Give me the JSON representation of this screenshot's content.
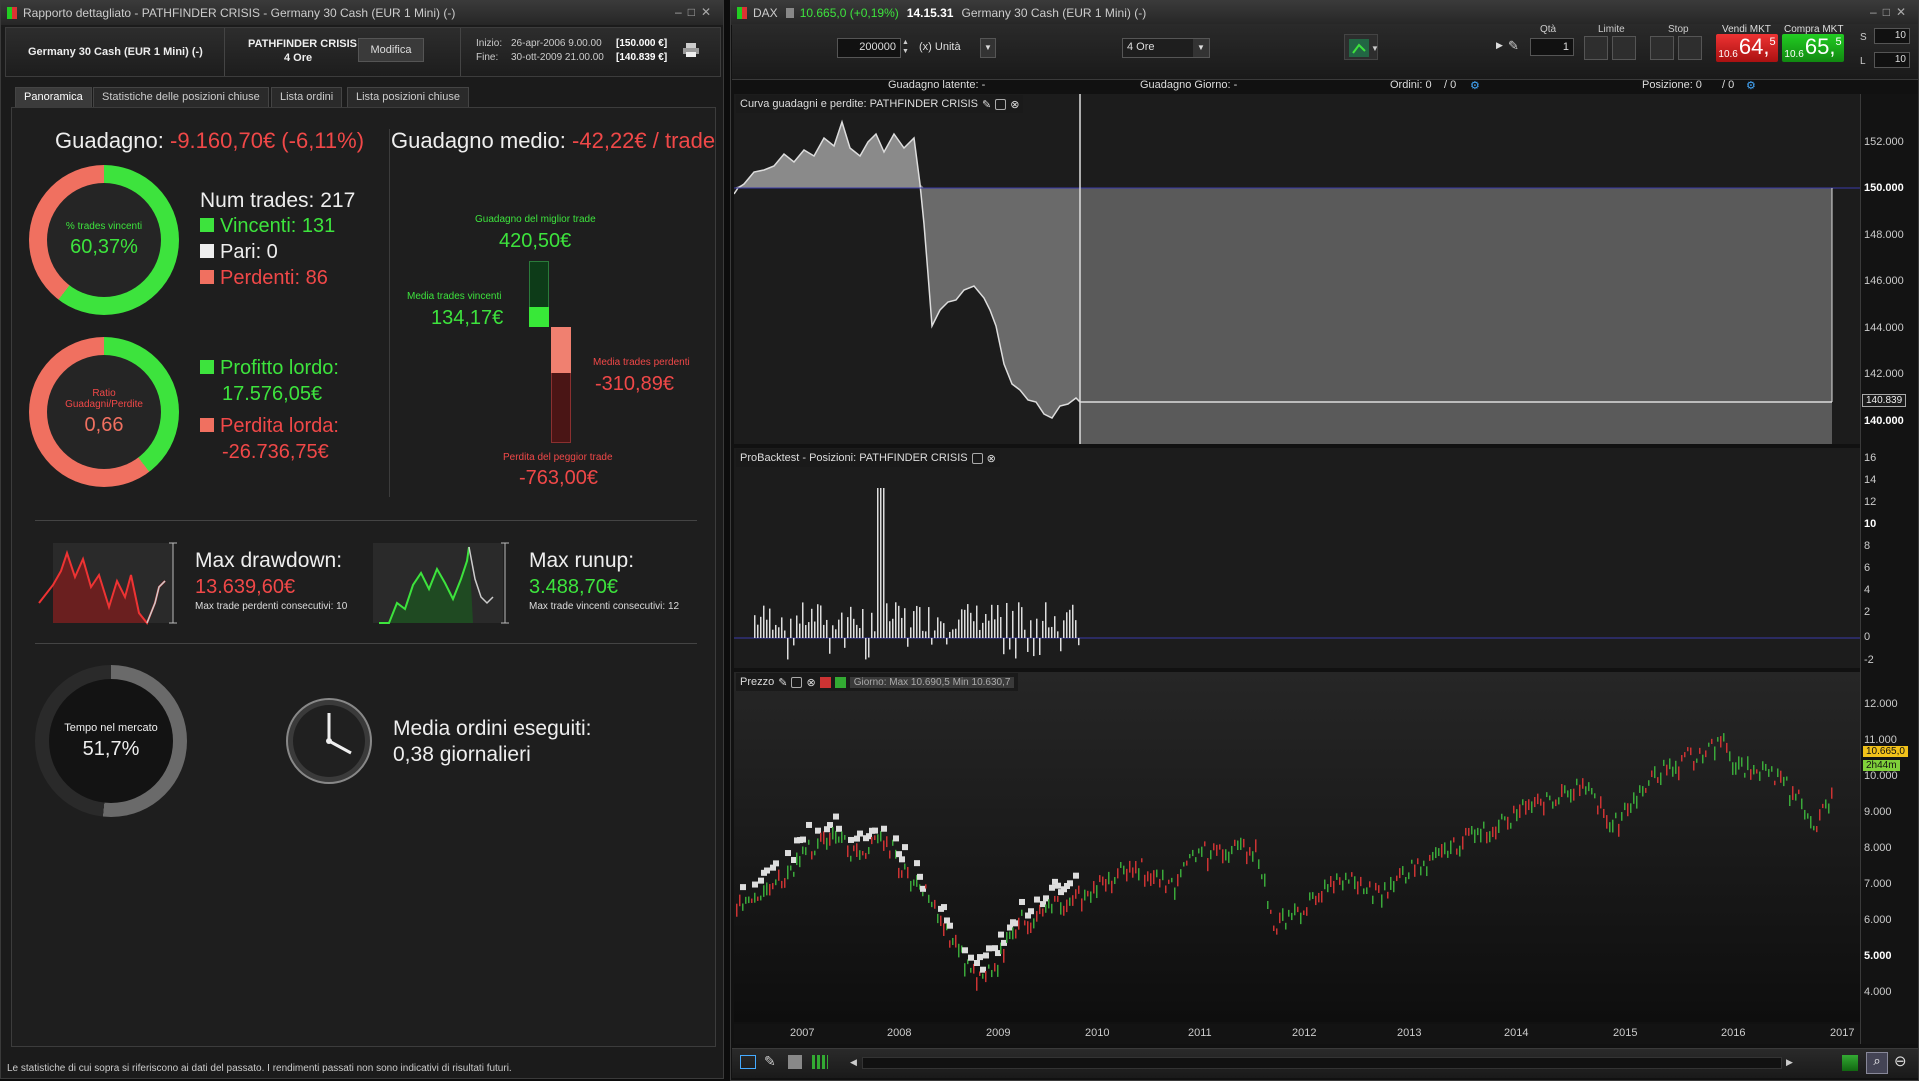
{
  "left_window": {
    "title": "Rapporto dettagliato - PATHFINDER CRISIS - Germany 30 Cash (EUR 1 Mini) (-)",
    "instrument": "Germany 30 Cash (EUR 1 Mini) (-)",
    "system_name": "PATHFINDER CRISIS",
    "timeframe": "4 Ore",
    "modify_label": "Modifica",
    "start_label": "Inizio:",
    "start_value": "26-apr-2006 9.00.00",
    "start_capital": "[150.000 €]",
    "end_label": "Fine:",
    "end_value": "30-ott-2009 21.00.00",
    "end_capital": "[140.839 €]",
    "tabs": [
      {
        "label": "Panoramica"
      },
      {
        "label": "Statistiche delle posizioni chiuse"
      },
      {
        "label": "Lista ordini"
      },
      {
        "label": "Lista posizioni chiuse"
      }
    ],
    "gain_label": "Guadagno:",
    "gain_value": "-9.160,70€ (-6,11%)",
    "avg_gain_label": "Guadagno medio:",
    "avg_gain_value": "-42,22€ / trade",
    "win_pct_label": "% trades vincenti",
    "win_pct_value": "60,37%",
    "win_pct_fraction": 0.6037,
    "num_trades": "Num trades: 217",
    "winners": "Vincenti: 131",
    "even": "Pari: 0",
    "losers": "Perdenti: 86",
    "ratio_label": "Ratio Guadagni/Perdite",
    "ratio_value": "0,66",
    "ratio_fraction": 0.397,
    "gross_profit_label": "Profitto lordo:",
    "gross_profit_value": "17.576,05€",
    "gross_loss_label": "Perdita lorda:",
    "gross_loss_value": "-26.736,75€",
    "best_trade_label": "Guadagno del miglior trade",
    "best_trade_value": "420,50€",
    "avg_win_label": "Media trades vincenti",
    "avg_win_value": "134,17€",
    "avg_loss_label": "Media trades perdenti",
    "avg_loss_value": "-310,89€",
    "worst_trade_label": "Perdita del peggior trade",
    "worst_trade_value": "-763,00€",
    "max_dd_label": "Max drawdown:",
    "max_dd_value": "13.639,60€",
    "max_consec_loss": "Max trade perdenti consecutivi: 10",
    "max_runup_label": "Max runup:",
    "max_runup_value": "3.488,70€",
    "max_consec_win": "Max trade vincenti consecutivi: 12",
    "time_in_market_label": "Tempo nel mercato",
    "time_in_market_value": "51,7%",
    "time_in_market_fraction": 0.517,
    "avg_orders_label": "Media ordini eseguiti:",
    "avg_orders_value": "0,38 giornalieri",
    "disclaimer": "Le statistiche di cui sopra si riferiscono ai dati del passato. I rendimenti passati non sono indicativi di risultati futuri."
  },
  "right_window": {
    "title_symbol": "DAX",
    "title_change": "10.665,0 (+0,19%)",
    "title_time": "14.15.31",
    "title_instrument": "Germany 30 Cash (EUR 1 Mini) (-)",
    "qty_value": "200000",
    "unit_label": "(x) Unità",
    "timeframe_value": "4 Ore",
    "qta_label": "Qtà",
    "qta_value": "1",
    "limit_label": "Limite",
    "stop_label": "Stop",
    "sell_label": "Vendi MKT",
    "sell_small": "10.6",
    "sell_big": "64,",
    "sell_sup": "5",
    "buy_label": "Compra MKT",
    "buy_small": "10.6",
    "buy_big": "65,",
    "buy_sup": "5",
    "s_label": "S",
    "s_value": "10",
    "l_label": "L",
    "l_value": "10",
    "latent_label": "Guadagno latente: -",
    "day_gain_label": "Guadagno Giorno: -",
    "orders_label": "Ordini: 0",
    "orders_slash": "/ 0",
    "position_label": "Posizione: 0",
    "position_slash": "/ 0",
    "equity_panel_title": "Curva guadagni e perdite: PATHFINDER CRISIS",
    "positions_panel_title": "ProBacktest - Posizioni: PATHFINDER CRISIS",
    "price_panel_title": "Prezzo",
    "price_legend": "Giorno: Max 10.690,5 Min 10.630,7",
    "equity_ticks": [
      "152.000",
      "150.000",
      "148.000",
      "146.000",
      "144.000",
      "142.000",
      "140.000"
    ],
    "equity_marker": "140.839",
    "positions_ticks": [
      "16",
      "14",
      "12",
      "10",
      "8",
      "6",
      "4",
      "2",
      "0",
      "-2"
    ],
    "price_ticks": [
      "12.000",
      "11.000",
      "10.000",
      "9.000",
      "8.000",
      "7.000",
      "6.000",
      "5.000",
      "4.000"
    ],
    "price_marker": "10.665,0",
    "price_marker_time": "2h44m",
    "years": [
      "2007",
      "2008",
      "2009",
      "2010",
      "2011",
      "2012",
      "2013",
      "2014",
      "2015",
      "2016",
      "2017"
    ]
  },
  "colors": {
    "green": "#3de33d",
    "red": "#f04848",
    "panel_bg": "#1e1e1e"
  }
}
